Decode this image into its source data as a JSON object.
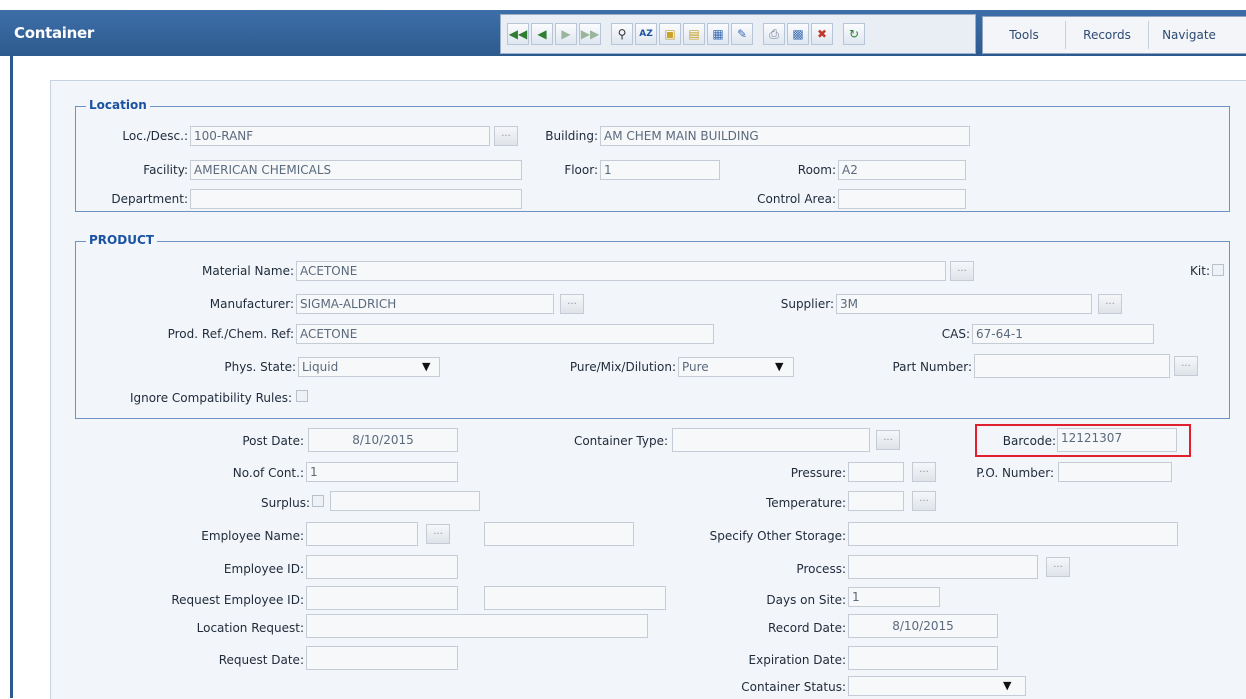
{
  "window": {
    "title": "Container"
  },
  "toolbar": {
    "icons": [
      "first-record-icon",
      "prev-record-icon",
      "next-record-icon",
      "last-record-icon",
      "find-icon",
      "sort-icon",
      "new-record-icon",
      "copy-record-icon",
      "delete-record-icon",
      "edit-record-icon",
      "print-icon",
      "save-icon",
      "cancel-icon",
      "refresh-icon"
    ]
  },
  "menu": {
    "tools": "Tools",
    "records": "Records",
    "navigate": "Navigate"
  },
  "location": {
    "legend": "Location",
    "loc_desc_label": "Loc./Desc.:",
    "loc_desc_value": "100-RANF",
    "building_label": "Building:",
    "building_value": "AM CHEM MAIN BUILDING",
    "facility_label": "Facility:",
    "facility_value": "AMERICAN CHEMICALS",
    "floor_label": "Floor:",
    "floor_value": "1",
    "room_label": "Room:",
    "room_value": "A2",
    "department_label": "Department:",
    "department_value": "",
    "control_area_label": "Control Area:",
    "control_area_value": ""
  },
  "product": {
    "legend": "PRODUCT",
    "material_name_label": "Material Name:",
    "material_name_value": "ACETONE",
    "kit_label": "Kit:",
    "manufacturer_label": "Manufacturer:",
    "manufacturer_value": "SIGMA-ALDRICH",
    "supplier_label": "Supplier:",
    "supplier_value": "3M",
    "prod_ref_label": "Prod. Ref./Chem. Ref:",
    "prod_ref_value": "ACETONE",
    "cas_label": "CAS:",
    "cas_value": "67-64-1",
    "phys_state_label": "Phys. State:",
    "phys_state_value": "Liquid",
    "pure_mix_label": "Pure/Mix/Dilution:",
    "pure_mix_value": "Pure",
    "part_number_label": "Part Number:",
    "part_number_value": "",
    "ignore_compat_label": "Ignore Compatibility Rules:"
  },
  "container": {
    "post_date_label": "Post Date:",
    "post_date_value": "8/10/2015",
    "container_type_label": "Container Type:",
    "container_type_value": "",
    "barcode_label": "Barcode:",
    "barcode_value": "12121307",
    "no_of_cont_label": "No.of Cont.:",
    "no_of_cont_value": "1",
    "pressure_label": "Pressure:",
    "pressure_value": "",
    "po_number_label": "P.O. Number:",
    "po_number_value": "",
    "surplus_label": "Surplus:",
    "surplus_value": "",
    "temperature_label": "Temperature:",
    "temperature_value": "",
    "employee_name_label": "Employee Name:",
    "employee_name_value": "",
    "employee_name_extra": "",
    "specify_other_storage_label": "Specify Other Storage:",
    "specify_other_storage_value": "",
    "employee_id_label": "Employee ID:",
    "employee_id_value": "",
    "process_label": "Process:",
    "process_value": "",
    "request_employee_id_label": "Request Employee ID:",
    "request_employee_id_value": "",
    "request_employee_extra": "",
    "days_on_site_label": "Days on Site:",
    "days_on_site_value": "1",
    "location_request_label": "Location Request:",
    "location_request_value": "",
    "record_date_label": "Record Date:",
    "record_date_value": "8/10/2015",
    "request_date_label": "Request Date:",
    "request_date_value": "",
    "expiration_date_label": "Expiration Date:",
    "expiration_date_value": "",
    "container_status_label": "Container Status:",
    "container_status_value": ""
  },
  "colors": {
    "header": "#2d5a8e",
    "legend": "#1b53a3",
    "highlight": "#e0202c"
  }
}
